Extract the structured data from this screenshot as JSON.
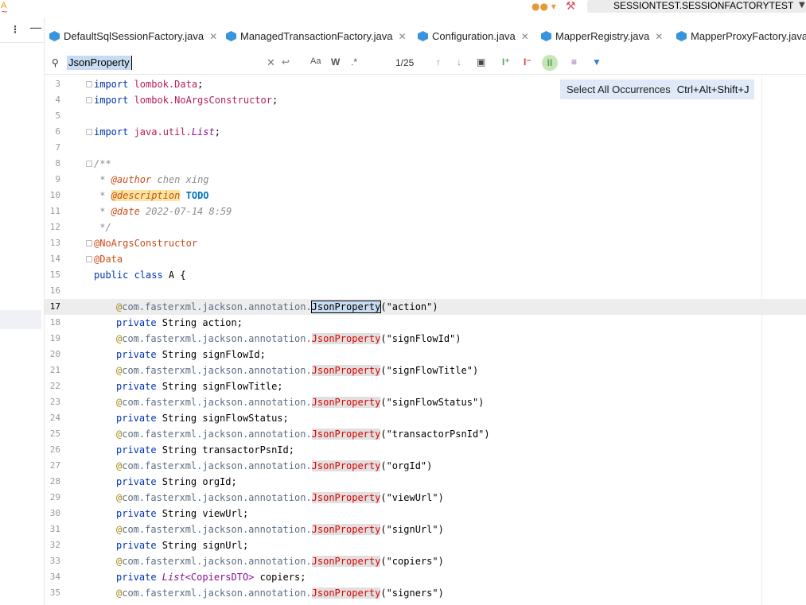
{
  "toolbar": {
    "run_config": "SESSIONTEST.SESSIONFACTORYTEST"
  },
  "tabs": [
    {
      "label": "DefaultSqlSessionFactory.java",
      "closable": true
    },
    {
      "label": "ManagedTransactionFactory.java",
      "closable": true
    },
    {
      "label": "Configuration.java",
      "closable": true
    },
    {
      "label": "MapperRegistry.java",
      "closable": true
    },
    {
      "label": "MapperProxyFactory.java",
      "closable": false
    }
  ],
  "search": {
    "query": "JsonProperty",
    "match_case": "Aa",
    "words": "W",
    "regex": ".*",
    "counter": "1/25"
  },
  "popup": {
    "label": "Select All Occurrences",
    "shortcut": "Ctrl+Alt+Shift+J"
  },
  "editor": {
    "current_line": 17,
    "lines": [
      {
        "n": "3"
      },
      {
        "n": "4"
      },
      {
        "n": "5"
      },
      {
        "n": "6"
      },
      {
        "n": "7"
      },
      {
        "n": "8"
      },
      {
        "n": "9"
      },
      {
        "n": "10"
      },
      {
        "n": "11"
      },
      {
        "n": "12"
      },
      {
        "n": "13"
      },
      {
        "n": "14"
      },
      {
        "n": "15"
      },
      {
        "n": "16"
      },
      {
        "n": "17"
      },
      {
        "n": "18"
      },
      {
        "n": "19"
      },
      {
        "n": "20"
      },
      {
        "n": "21"
      },
      {
        "n": "22"
      },
      {
        "n": "23"
      },
      {
        "n": "24"
      },
      {
        "n": "25"
      },
      {
        "n": "26"
      },
      {
        "n": "27"
      },
      {
        "n": "28"
      },
      {
        "n": "29"
      },
      {
        "n": "30"
      },
      {
        "n": "31"
      },
      {
        "n": "32"
      },
      {
        "n": "33"
      },
      {
        "n": "34"
      },
      {
        "n": "35"
      }
    ],
    "text": {
      "l3_kw": "import ",
      "l3_pkg": "lombok.Data",
      "l3_semi": ";",
      "l4_kw": "import ",
      "l4_pkg": "lombok.NoArgsConstructor",
      "l4_semi": ";",
      "l6_kw": "import ",
      "l6_pkg": "java.util.",
      "l6_typ": "List",
      "l6_semi": ";",
      "l8": "/**",
      "l9_star": " * ",
      "l9_tag": "@author",
      "l9_rest": " chen xing",
      "l10_star": " * ",
      "l10_tag": "@description",
      "l10_sp": " ",
      "l10_todo": "TODO",
      "l11_star": " * ",
      "l11_tag": "@date",
      "l11_rest": " 2022-07-14 8:59",
      "l12": " */",
      "l13": "@NoArgsConstructor",
      "l14": "@Data",
      "l15_kw": "public class ",
      "l15_name": "A",
      "l15_brace": " {",
      "at": "@",
      "fq": "com.fasterxml.jackson.annotation.",
      "match": "JsonProperty",
      "private": "private ",
      "String": "String ",
      "List": "List",
      "l34_gen": "<CopiersDTO>",
      "a17": "(\"action\")",
      "f18": "action;",
      "a19": "(\"signFlowId\")",
      "f20": "signFlowId;",
      "a21": "(\"signFlowTitle\")",
      "f22": "signFlowTitle;",
      "a23": "(\"signFlowStatus\")",
      "f24": "signFlowStatus;",
      "a25": "(\"transactorPsnId\")",
      "f26": "transactorPsnId;",
      "a27": "(\"orgId\")",
      "f28": "orgId;",
      "a29": "(\"viewUrl\")",
      "f30": "viewUrl;",
      "a31": "(\"signUrl\")",
      "f32": "signUrl;",
      "a33": "(\"copiers\")",
      "f34": " copiers;",
      "a35": "(\"signers\")"
    }
  }
}
